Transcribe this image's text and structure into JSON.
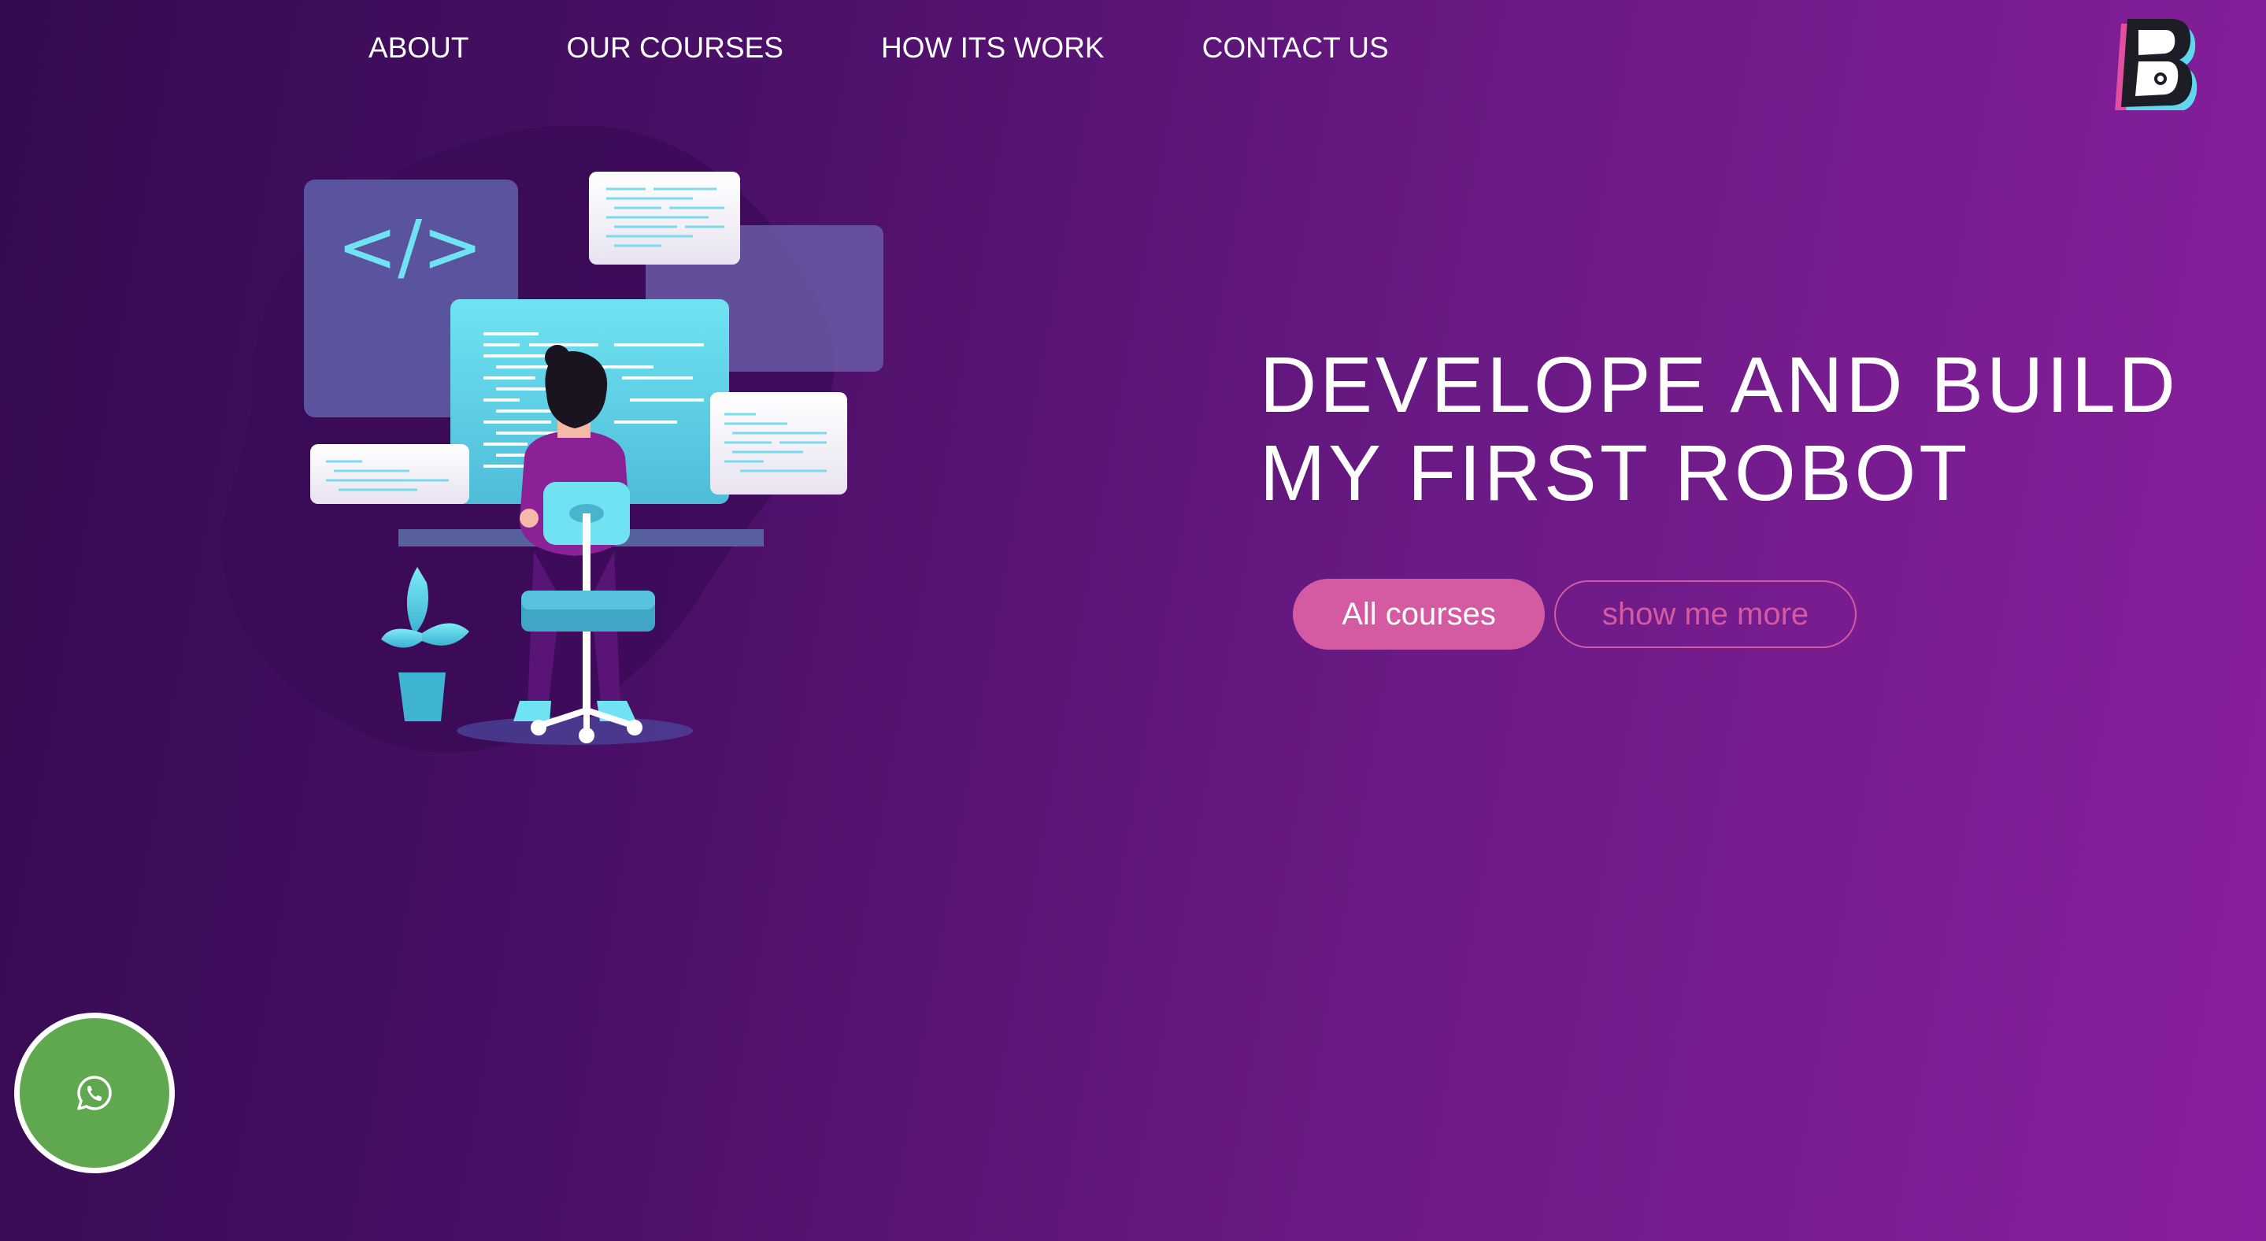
{
  "nav": {
    "items": [
      {
        "label": "ABOUT"
      },
      {
        "label": "OUR COURSES"
      },
      {
        "label": "HOW ITS WORK"
      },
      {
        "label": "CONTACT US"
      }
    ]
  },
  "logo": {
    "letter": "B"
  },
  "hero": {
    "title_line1": "DEVELOPE AND BUILD",
    "title_line2": "MY FIRST ROBOT",
    "primary_button": "All courses",
    "secondary_button": "show me more",
    "code_symbol": "</>"
  },
  "colors": {
    "accent_pink": "#d45aa2",
    "whatsapp_green": "#5fa84f",
    "cyan": "#6be0ef"
  },
  "icons": {
    "floating_button": "whatsapp-icon",
    "code": "code-brackets-icon"
  }
}
